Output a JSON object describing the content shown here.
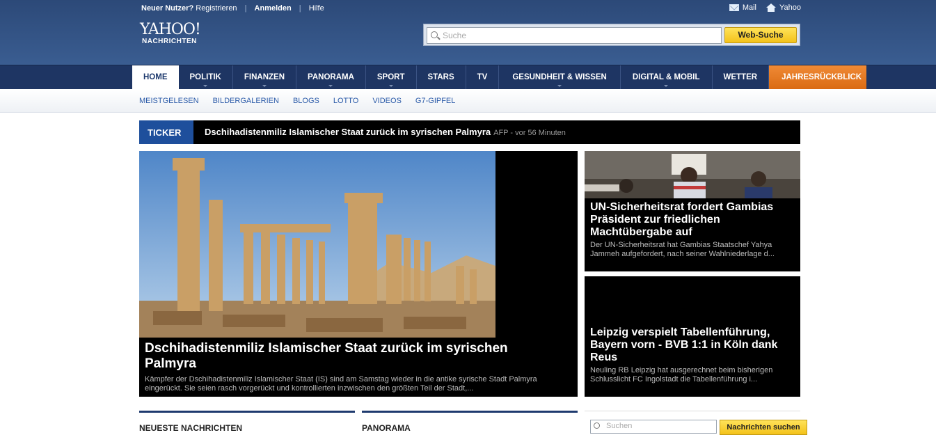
{
  "topbar": {
    "new_user": "Neuer Nutzer?",
    "register": "Registrieren",
    "login": "Anmelden",
    "help": "Hilfe",
    "mail": "Mail",
    "yahoo": "Yahoo"
  },
  "logo": {
    "line1": "YAHOO!",
    "line2": "NACHRICHTEN"
  },
  "search": {
    "placeholder": "Suche",
    "button": "Web-Suche"
  },
  "nav": [
    {
      "label": "HOME"
    },
    {
      "label": "POLITIK"
    },
    {
      "label": "FINANZEN"
    },
    {
      "label": "PANORAMA"
    },
    {
      "label": "SPORT"
    },
    {
      "label": "STARS"
    },
    {
      "label": "TV"
    },
    {
      "label": "GESUNDHEIT & WISSEN"
    },
    {
      "label": "DIGITAL & MOBIL"
    },
    {
      "label": "WETTER"
    },
    {
      "label": "JAHRESRÜCKBLICK"
    }
  ],
  "subnav": [
    "MEISTGELESEN",
    "BILDERGALERIEN",
    "BLOGS",
    "LOTTO",
    "VIDEOS",
    "G7-GIPFEL"
  ],
  "ticker": {
    "label": "TICKER",
    "headline": "Dschihadistenmiliz Islamischer Staat zurück im syrischen Palmyra",
    "source": "AFP - vor 56 Minuten"
  },
  "main_story": {
    "title": "Dschihadistenmiliz Islamischer Staat zurück im syrischen Palmyra",
    "summary": "Kämpfer der Dschihadistenmiliz Islamischer Staat (IS) sind am Samstag wieder in die antike syrische Stadt Palmyra eingerückt. Sie seien rasch vorgerückt und kontrollierten inzwischen den größten Teil der Stadt,..."
  },
  "side_stories": [
    {
      "title": "UN-Sicherheitsrat fordert Gambias Präsident zur friedlichen Machtübergabe auf",
      "summary": "Der UN-Sicherheitsrat hat Gambias Staatschef Yahya Jammeh aufgefordert, nach seiner Wahlniederlage d..."
    },
    {
      "title": "Leipzig verspielt Tabellenführung, Bayern vorn - BVB 1:1 in Köln dank Reus",
      "summary": "Neuling RB Leipzig hat ausgerechnet beim bisherigen Schlusslicht FC Ingolstadt die Tabellenführung i..."
    }
  ],
  "bottom": {
    "head1": "NEUESTE NACHRICHTEN",
    "head2": "PANORAMA",
    "search_placeholder": "Suchen",
    "search_button": "Nachrichten suchen"
  },
  "colors": {
    "header": "#2c4978",
    "nav": "#1e3563",
    "accent_orange": "#e67a22",
    "ticker_label": "#1e4f9c",
    "search_button": "#f7cd2a"
  }
}
